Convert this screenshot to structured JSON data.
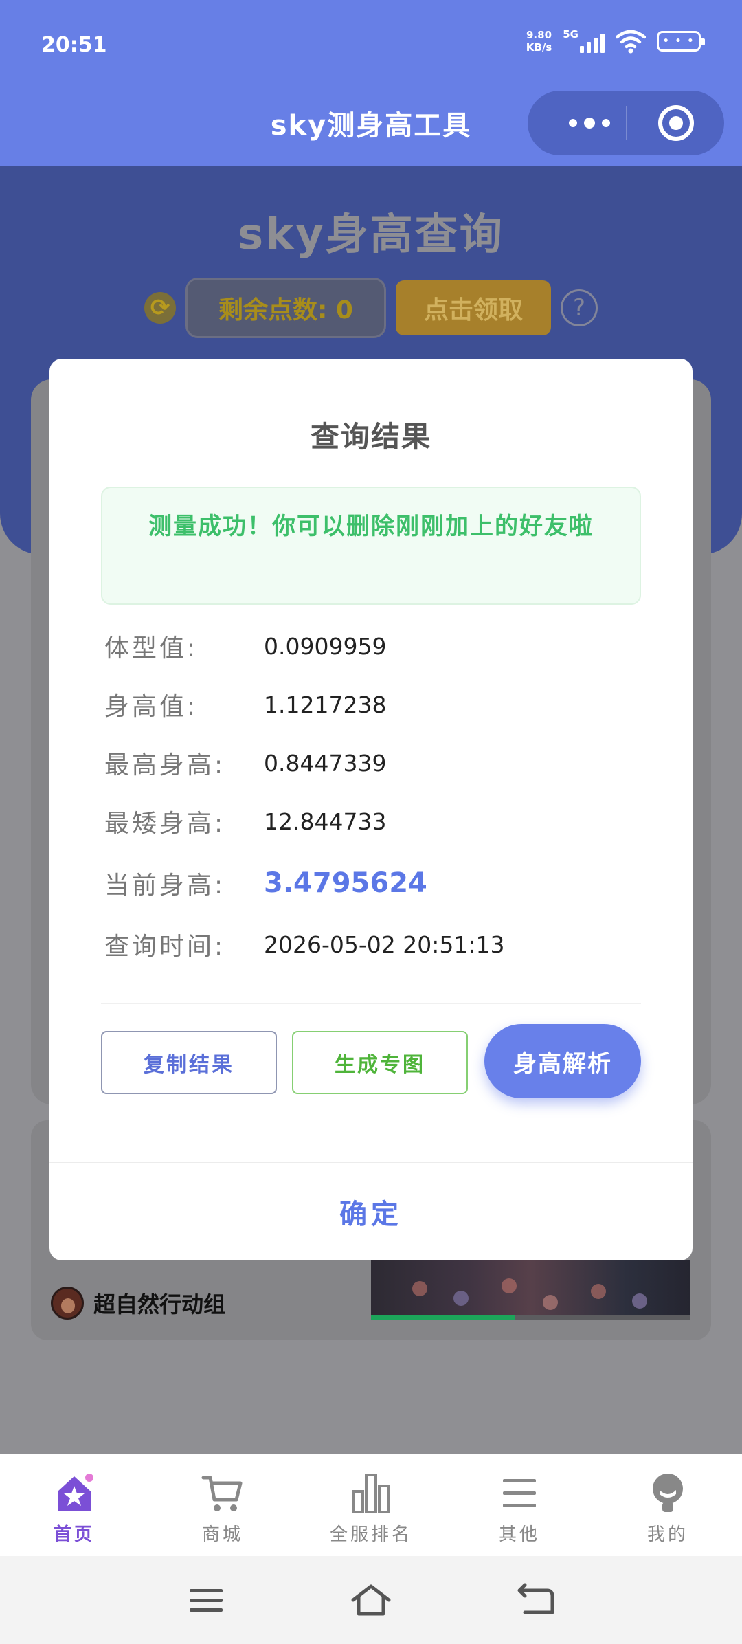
{
  "status_bar": {
    "time": "20:51",
    "net_speed_value": "9.80",
    "net_speed_unit": "KB/s",
    "network": "5G",
    "battery_text": "• • •"
  },
  "nav_bar": {
    "title": "sky测身高工具"
  },
  "page": {
    "title": "sky身高查询",
    "points_label": "剩余点数: 0",
    "claim_button": "点击领取",
    "help_icon_text": "?",
    "refresh_icon_text": "⟳",
    "group_name": "超自然行动组"
  },
  "modal": {
    "title": "查询结果",
    "success_message": "测量成功！你可以删除刚刚加上的好友啦",
    "results": [
      {
        "label": "体型值:",
        "value": "0.0909959"
      },
      {
        "label": "身高值:",
        "value": "1.1217238"
      },
      {
        "label": "最高身高:",
        "value": "0.8447339"
      },
      {
        "label": "最矮身高:",
        "value": "12.844733"
      },
      {
        "label": "当前身高:",
        "value": "3.4795624"
      },
      {
        "label": "查询时间:",
        "value": "2026-05-02 20:51:13"
      }
    ],
    "copy_button": "复制结果",
    "generate_button": "生成专图",
    "analyze_button": "身高解析",
    "confirm_button": "确定"
  },
  "tab_bar": {
    "tabs": [
      {
        "label": "首页",
        "icon": "home-star-icon",
        "active": true
      },
      {
        "label": "商城",
        "icon": "cart-icon",
        "active": false
      },
      {
        "label": "全服排名",
        "icon": "bar-chart-icon",
        "active": false
      },
      {
        "label": "其他",
        "icon": "menu-icon",
        "active": false
      },
      {
        "label": "我的",
        "icon": "profile-icon",
        "active": false
      }
    ]
  },
  "colors": {
    "accent": "#677fe6",
    "success": "#3dbf6a",
    "active_tab": "#7b4fd6"
  }
}
